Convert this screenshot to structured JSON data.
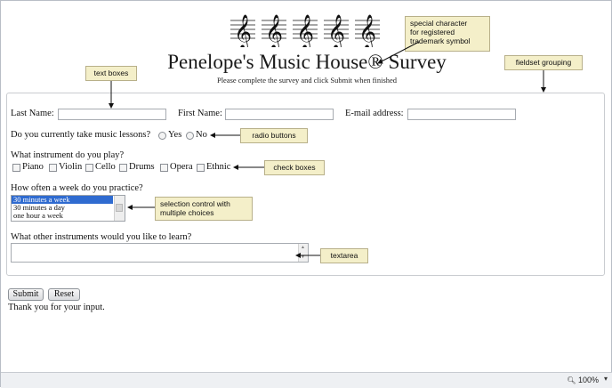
{
  "page": {
    "title": "Penelope's Music House® Survey",
    "subtitle": "Please complete the survey and click Submit when finished"
  },
  "form": {
    "last_name_label": "Last Name:",
    "first_name_label": "First Name:",
    "email_label": "E-mail address:",
    "lessons_question": "Do you currently take music lessons?",
    "lessons_yes": "Yes",
    "lessons_no": "No",
    "instrument_question": "What instrument do you play?",
    "instruments": [
      "Piano",
      "Violin",
      "Cello",
      "Drums",
      "Opera",
      "Ethnic"
    ],
    "practice_question": "How often a week do you practice?",
    "practice_options": [
      "30 minutes a week",
      "30 minutes a day",
      "one hour a week"
    ],
    "practice_selected": "30 minutes a week",
    "other_question": "What other instruments would you like to learn?",
    "submit_label": "Submit",
    "reset_label": "Reset",
    "thanks": "Thank you for your input."
  },
  "callouts": {
    "special": "special character for registered trademark symbol",
    "special_lines": [
      "special character",
      "for registered",
      "trademark symbol"
    ],
    "textboxes": "text boxes",
    "fieldset": "fieldset grouping",
    "radio": "radio buttons",
    "checkboxes": "check boxes",
    "selection_lines": [
      "selection control with",
      "multiple choices"
    ],
    "textarea": "textarea"
  },
  "statusbar": {
    "zoom": "100%"
  },
  "colors": {
    "callout_bg": "#f4efc9",
    "selection": "#2f6bd0"
  }
}
